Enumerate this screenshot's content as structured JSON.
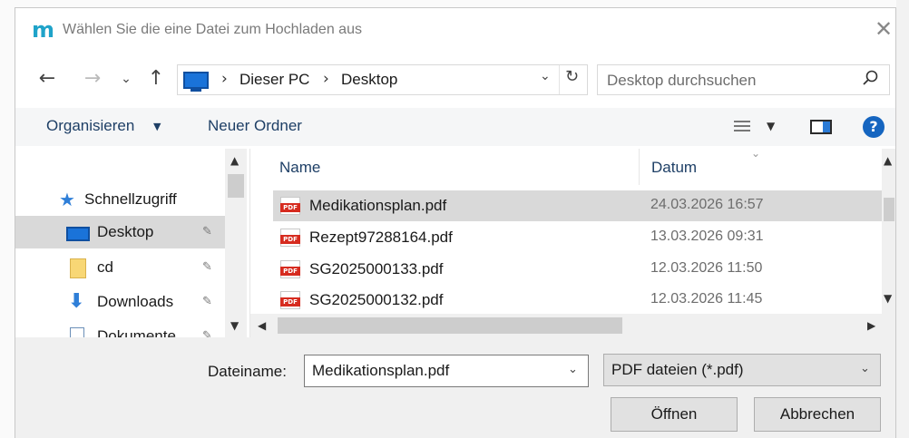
{
  "window": {
    "app_logo": "m",
    "title": "Wählen Sie die eine Datei zum Hochladen aus",
    "close_glyph": "✕"
  },
  "nav": {
    "back": "←",
    "forward": "→",
    "recent": "⌄",
    "up": "↑",
    "breadcrumb": [
      "Dieser PC",
      "Desktop"
    ],
    "separator": "›",
    "dropdown_glyph": "⌄",
    "refresh_glyph": "↻"
  },
  "search": {
    "placeholder": "Desktop durchsuchen",
    "icon": "search-icon"
  },
  "toolbar": {
    "organize_label": "Organisieren",
    "new_folder_label": "Neuer Ordner",
    "help_glyph": "?"
  },
  "sidebar": {
    "items": [
      {
        "label": "Schnellzugriff",
        "icon": "star-icon"
      },
      {
        "label": "Desktop",
        "icon": "desktop-icon",
        "selected": true
      },
      {
        "label": "cd",
        "icon": "folder-icon"
      },
      {
        "label": "Downloads",
        "icon": "download-icon"
      },
      {
        "label": "Dokumente",
        "icon": "document-icon"
      }
    ],
    "pin_glyph": "📌"
  },
  "files": {
    "columns": [
      "Name",
      "Datum"
    ],
    "rows": [
      {
        "name": "Medikationsplan.pdf",
        "date": "24.03.2026 16:57",
        "selected": true
      },
      {
        "name": "Rezept97288164.pdf",
        "date": "13.03.2026 09:31"
      },
      {
        "name": "SG2025000133.pdf",
        "date": "12.03.2026 11:50"
      },
      {
        "name": "SG2025000132.pdf",
        "date": "12.03.2026 11:45"
      }
    ],
    "pdf_badge": "PDF"
  },
  "bottom": {
    "filename_label": "Dateiname:",
    "filename_value": "Medikationsplan.pdf",
    "filetype_value": "PDF dateien (*.pdf)",
    "open_label": "Öffnen",
    "cancel_label": "Abbrechen"
  }
}
